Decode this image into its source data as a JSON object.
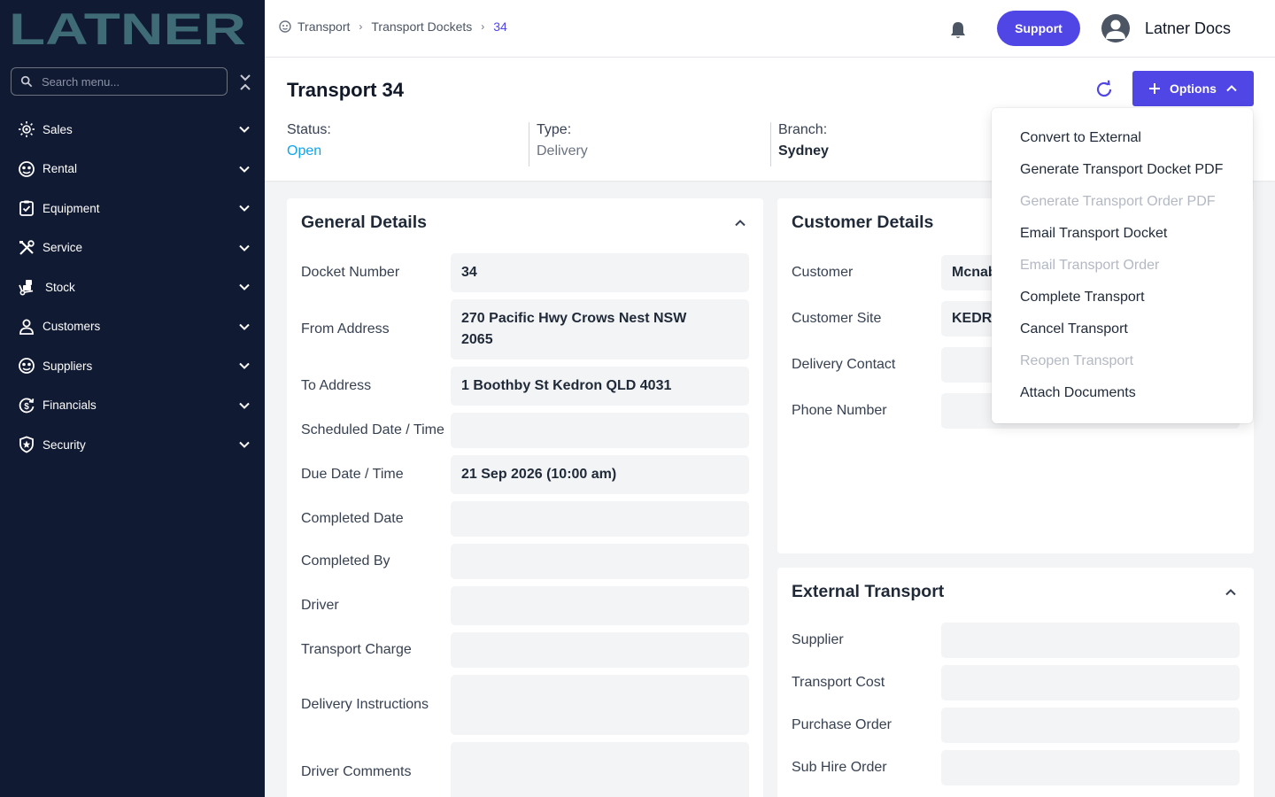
{
  "brand": {
    "name": "LATNER"
  },
  "sidebar": {
    "search_placeholder": "Search menu...",
    "items": [
      {
        "label": "Sales",
        "icon": "sun-icon"
      },
      {
        "label": "Rental",
        "icon": "face-icon"
      },
      {
        "label": "Equipment",
        "icon": "clipboard-icon"
      },
      {
        "label": "Service",
        "icon": "tools-icon"
      },
      {
        "label": "Stock",
        "icon": "dolly-icon"
      },
      {
        "label": "Customers",
        "icon": "person-icon"
      },
      {
        "label": "Suppliers",
        "icon": "face-icon"
      },
      {
        "label": "Financials",
        "icon": "dollar-cycle-icon"
      },
      {
        "label": "Security",
        "icon": "shield-icon"
      }
    ]
  },
  "header": {
    "breadcrumbs": [
      "Transport",
      "Transport Dockets",
      "34"
    ],
    "support_label": "Support",
    "user_name": "Latner Docs"
  },
  "page": {
    "title": "Transport",
    "number": "34",
    "options_label": "Options",
    "status_label": "Status:",
    "status_value": "Open",
    "type_label": "Type:",
    "type_value": "Delivery",
    "branch_label": "Branch:",
    "branch_value": "Sydney"
  },
  "general": {
    "title": "General Details",
    "fields": [
      {
        "label": "Docket Number",
        "value": "34"
      },
      {
        "label": "From Address",
        "value": "270 Pacific Hwy Crows Nest NSW 2065"
      },
      {
        "label": "To Address",
        "value": "1 Boothby St Kedron QLD 4031"
      },
      {
        "label": "Scheduled Date / Time",
        "value": ""
      },
      {
        "label": "Due Date / Time",
        "value": "21 Sep 2026 (10:00 am)"
      },
      {
        "label": "Completed Date",
        "value": ""
      },
      {
        "label": "Completed By",
        "value": ""
      },
      {
        "label": "Driver",
        "value": ""
      },
      {
        "label": "Transport Charge",
        "value": ""
      },
      {
        "label": "Delivery Instructions",
        "value": ""
      },
      {
        "label": "Driver Comments",
        "value": ""
      }
    ]
  },
  "customer": {
    "title": "Customer Details",
    "fields": [
      {
        "label": "Customer",
        "value": "Mcnab"
      },
      {
        "label": "Customer Site",
        "value": "KEDRO"
      },
      {
        "label": "Delivery Contact",
        "value": ""
      },
      {
        "label": "Phone Number",
        "value": ""
      }
    ]
  },
  "external": {
    "title": "External Transport",
    "fields": [
      {
        "label": "Supplier",
        "value": ""
      },
      {
        "label": "Transport Cost",
        "value": ""
      },
      {
        "label": "Purchase Order",
        "value": ""
      },
      {
        "label": "Sub Hire Order",
        "value": ""
      }
    ]
  },
  "options_menu": {
    "items": [
      {
        "label": "Convert to External",
        "enabled": true
      },
      {
        "label": "Generate Transport Docket PDF",
        "enabled": true
      },
      {
        "label": "Generate Transport Order PDF",
        "enabled": false
      },
      {
        "label": "Email Transport Docket",
        "enabled": true
      },
      {
        "label": "Email Transport Order",
        "enabled": false
      },
      {
        "label": "Complete Transport",
        "enabled": true
      },
      {
        "label": "Cancel Transport",
        "enabled": true
      },
      {
        "label": "Reopen Transport",
        "enabled": false
      },
      {
        "label": "Attach Documents",
        "enabled": true
      }
    ]
  },
  "colors": {
    "sidebar_bg": "#111a33",
    "accent": "#4f46e5",
    "status_open": "#0ea5e9",
    "logo": "#3f6b76"
  }
}
